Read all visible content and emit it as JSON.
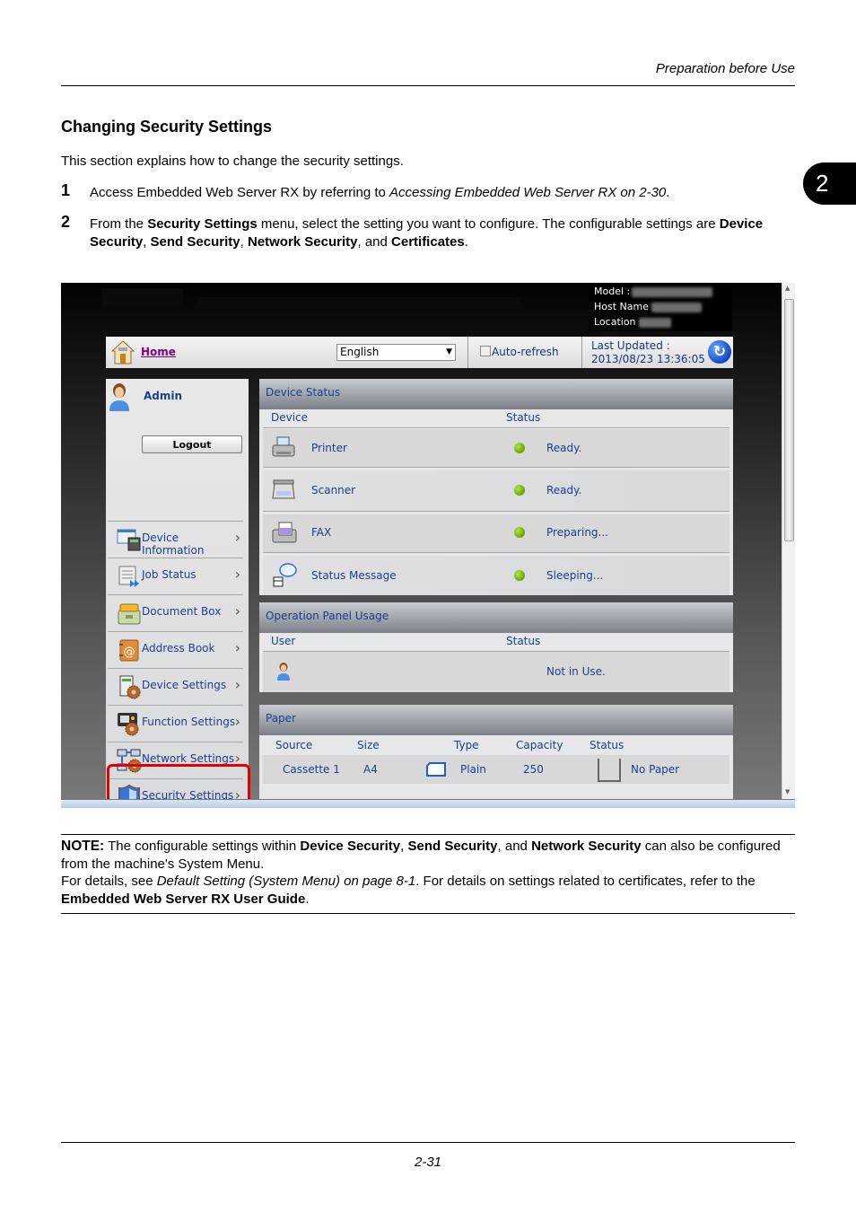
{
  "header": {
    "section_label": "Preparation before Use",
    "chapter_number": "2"
  },
  "section": {
    "title": "Changing Security Settings",
    "intro": "This section explains how to change the security settings.",
    "steps": [
      {
        "number": "1",
        "text_a": "Access Embedded Web Server RX by referring to ",
        "text_italic": "Accessing Embedded Web Server RX on 2-30",
        "text_b": "."
      },
      {
        "number": "2",
        "text_a": "From the ",
        "bold1": "Security Settings",
        "text_b": " menu, select the setting you want to configure. The configurable settings are ",
        "bold2": "Device Security",
        "sep1": ", ",
        "bold3": "Send Security",
        "sep2": ", ",
        "bold4": "Network Security",
        "sep3": ", and ",
        "bold5": "Certificates",
        "end": "."
      }
    ]
  },
  "ews": {
    "device_info": {
      "model_label": "Model :",
      "host_label": "Host Name :",
      "location_label": "Location :"
    },
    "topbar": {
      "home": "Home",
      "language": "English",
      "auto_refresh": "Auto-refresh",
      "last_updated_label": "Last Updated :",
      "last_updated_value": "2013/08/23 13:36:05"
    },
    "sidebar": {
      "user": "Admin",
      "logout": "Logout",
      "items": [
        {
          "label": "Device Information",
          "icon": "device-information-icon"
        },
        {
          "label": "Job Status",
          "icon": "job-status-icon"
        },
        {
          "label": "Document Box",
          "icon": "document-box-icon"
        },
        {
          "label": "Address Book",
          "icon": "address-book-icon"
        },
        {
          "label": "Device Settings",
          "icon": "device-settings-icon"
        },
        {
          "label": "Function Settings",
          "icon": "function-settings-icon"
        },
        {
          "label": "Network Settings",
          "icon": "network-settings-icon"
        },
        {
          "label": "Security Settings",
          "icon": "security-settings-icon"
        }
      ],
      "highlight_color": "#e30000"
    },
    "device_status": {
      "title": "Device Status",
      "col_device": "Device",
      "col_status": "Status",
      "rows": [
        {
          "device": "Printer",
          "status": "Ready."
        },
        {
          "device": "Scanner",
          "status": "Ready."
        },
        {
          "device": "FAX",
          "status": "Preparing..."
        },
        {
          "device": "Status Message",
          "status": "Sleeping..."
        }
      ]
    },
    "panel_usage": {
      "title": "Operation Panel Usage",
      "col_user": "User",
      "col_status": "Status",
      "status": "Not in Use."
    },
    "paper": {
      "title": "Paper",
      "columns": [
        "Source",
        "Size",
        "Type",
        "Capacity",
        "Status"
      ],
      "rows": [
        {
          "source": "Cassette 1",
          "size": "A4",
          "type": "Plain",
          "capacity": "250",
          "status": "No Paper"
        }
      ]
    }
  },
  "note": {
    "label": "NOTE:",
    "t1": " The configurable settings within ",
    "b1": "Device Security",
    "t2": ", ",
    "b2": "Send Security",
    "t3": ", and ",
    "b3": "Network Security",
    "t4": " can also be configured from the machine's System Menu.",
    "t5": "For details, see ",
    "i1": "Default Setting (System Menu) on page 8-1",
    "t6": ". For details on settings related to certificates, refer to the ",
    "b4": "Embedded Web Server RX User Guide",
    "t7": "."
  },
  "footer": {
    "page_number": "2-31"
  }
}
